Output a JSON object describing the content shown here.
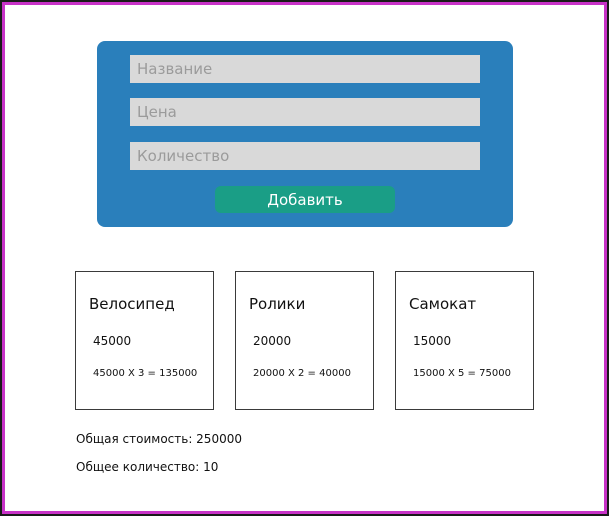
{
  "colors": {
    "panel": "#2a7fbb",
    "button": "#1a9e86"
  },
  "form": {
    "name_placeholder": "Название",
    "price_placeholder": "Цена",
    "quantity_placeholder": "Количество",
    "add_label": "Добавить"
  },
  "products": [
    {
      "name": "Велосипед",
      "price": "45000",
      "calc": "45000 X 3 = 135000"
    },
    {
      "name": "Ролики",
      "price": "20000",
      "calc": "20000 X 2 = 40000"
    },
    {
      "name": "Самокат",
      "price": "15000",
      "calc": "15000 X 5 = 75000"
    }
  ],
  "summary": {
    "total_cost": "Общая стоимость: 250000",
    "total_quantity": "Общее количество: 10"
  }
}
